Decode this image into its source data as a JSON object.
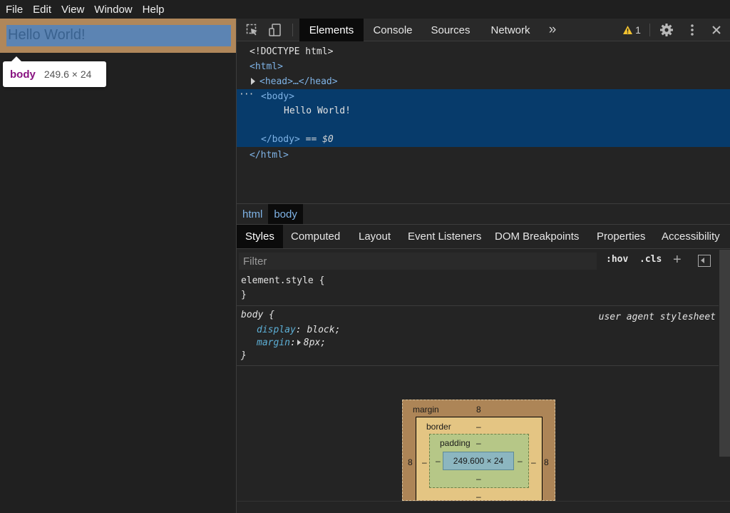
{
  "menubar": {
    "items": [
      "File",
      "Edit",
      "View",
      "Window",
      "Help"
    ]
  },
  "viewport": {
    "page_text": "Hello World!",
    "tooltip": {
      "tag": "body",
      "size": "249.6 × 24"
    }
  },
  "toolbar": {
    "tabs": [
      "Elements",
      "Console",
      "Sources",
      "Network"
    ],
    "active_tab": "Elements",
    "more_tabs_glyph": "»",
    "warning_count": "1",
    "icons": [
      "inspect-element-icon",
      "device-toolbar-icon",
      "more-tabs-icon",
      "warning-icon",
      "settings-gear-icon",
      "kebab-menu-icon",
      "close-icon"
    ]
  },
  "dom": {
    "doctype": "<!DOCTYPE html>",
    "html_open": "<html>",
    "head_collapsed": "<head>…</head>",
    "body_open": "<body>",
    "body_text": "Hello World!",
    "body_close": "</body>",
    "selected_marker": "== $0",
    "html_close": "</html>",
    "ellipsis": "···"
  },
  "breadcrumb": {
    "items": [
      "html",
      "body"
    ],
    "active": "body"
  },
  "subtabs": {
    "items": [
      "Styles",
      "Computed",
      "Layout",
      "Event Listeners",
      "DOM Breakpoints",
      "Properties",
      "Accessibility"
    ],
    "active": "Styles"
  },
  "filter": {
    "placeholder": "Filter",
    "value": "",
    "hov": ":hov",
    "cls": ".cls"
  },
  "styles": {
    "element_style_open": "element.style {",
    "element_style_close": "}",
    "body_rule_open": "body {",
    "body_rule_source": "user agent stylesheet",
    "declarations": [
      {
        "prop": "display",
        "value": "block;"
      },
      {
        "prop": "margin",
        "value": "8px;"
      }
    ],
    "body_rule_close": "}"
  },
  "box_model": {
    "margin_label": "margin",
    "margin_top": "8",
    "margin_left": "8",
    "margin_right": "8",
    "margin_bottom": "–",
    "border_label": "border",
    "border_top": "–",
    "border_left": "–",
    "border_right": "–",
    "border_bottom": "–",
    "padding_label": "padding",
    "padding_top": "–",
    "padding_left": "–",
    "padding_right": "–",
    "padding_bottom": "–",
    "content_size": "249.600 × 24"
  },
  "colors": {
    "selection_bg": "#073b6b",
    "tag_color": "#7fb3e6",
    "property_color": "#5db0d7",
    "margin_box": "#ad8557",
    "border_box": "#e4c583",
    "padding_box": "#b6c787",
    "content_box": "#8cb6c0",
    "warning": "#f2c230"
  }
}
